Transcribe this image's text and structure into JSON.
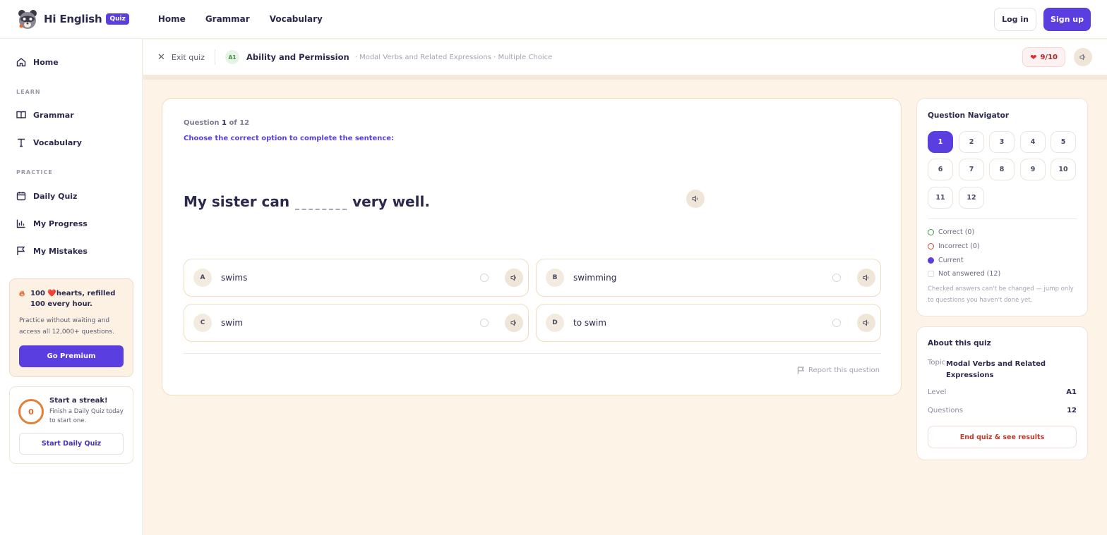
{
  "brand": {
    "name": "Hi English",
    "badge": "Quiz"
  },
  "topnav": {
    "items": [
      "Home",
      "Grammar",
      "Vocabulary"
    ]
  },
  "auth": {
    "login": "Log in",
    "signup": "Sign up"
  },
  "sidebar": {
    "home": "Home",
    "learn_heading": "LEARN",
    "grammar": "Grammar",
    "vocabulary": "Vocabulary",
    "practice_heading": "PRACTICE",
    "daily_quiz": "Daily Quiz",
    "my_progress": "My Progress",
    "my_mistakes": "My Mistakes"
  },
  "premium": {
    "flame_icon": "flame-icon",
    "title": "100 ❤️hearts, refilled 100 every hour.",
    "desc": "Practice without waiting and access all 12,000+ questions.",
    "button": "Go Premium"
  },
  "streak": {
    "count": "0",
    "title": "Start a streak!",
    "desc": "Finish a Daily Quiz today to start one.",
    "button": "Start Daily Quiz"
  },
  "quizbar": {
    "exit": "Exit quiz",
    "level": "A1",
    "title": "Ability and Permission",
    "subtitle": "· Modal Verbs and Related Expressions · Multiple Choice",
    "hearts": "9/10"
  },
  "question": {
    "label_prefix": "Question",
    "number": "1",
    "label_suffix": "of 12",
    "prompt": "Choose the correct option to complete the sentence:",
    "before_blank": "My sister can",
    "after_blank": "very well.",
    "options": [
      {
        "letter": "A",
        "text": "swims"
      },
      {
        "letter": "B",
        "text": "swimming"
      },
      {
        "letter": "C",
        "text": "swim"
      },
      {
        "letter": "D",
        "text": "to swim"
      }
    ],
    "report": "Report this question"
  },
  "navigator": {
    "title": "Question Navigator",
    "numbers": [
      "1",
      "2",
      "3",
      "4",
      "5",
      "6",
      "7",
      "8",
      "9",
      "10",
      "11",
      "12"
    ],
    "current": "1",
    "legend": {
      "correct": "Correct (0)",
      "incorrect": "Incorrect (0)",
      "current": "Current",
      "not_answered": "Not answered (12)"
    },
    "note": "Checked answers can't be changed — jump only to questions you haven't done yet."
  },
  "about": {
    "title": "About this quiz",
    "topic_label": "Topic",
    "topic_value": "Modal Verbs and Related Expressions",
    "level_label": "Level",
    "level_value": "A1",
    "questions_label": "Questions",
    "questions_value": "12",
    "end_button": "End quiz & see results"
  },
  "colors": {
    "accent": "#5b3ee0",
    "background": "#fdf3e7",
    "danger": "#c0392b"
  }
}
